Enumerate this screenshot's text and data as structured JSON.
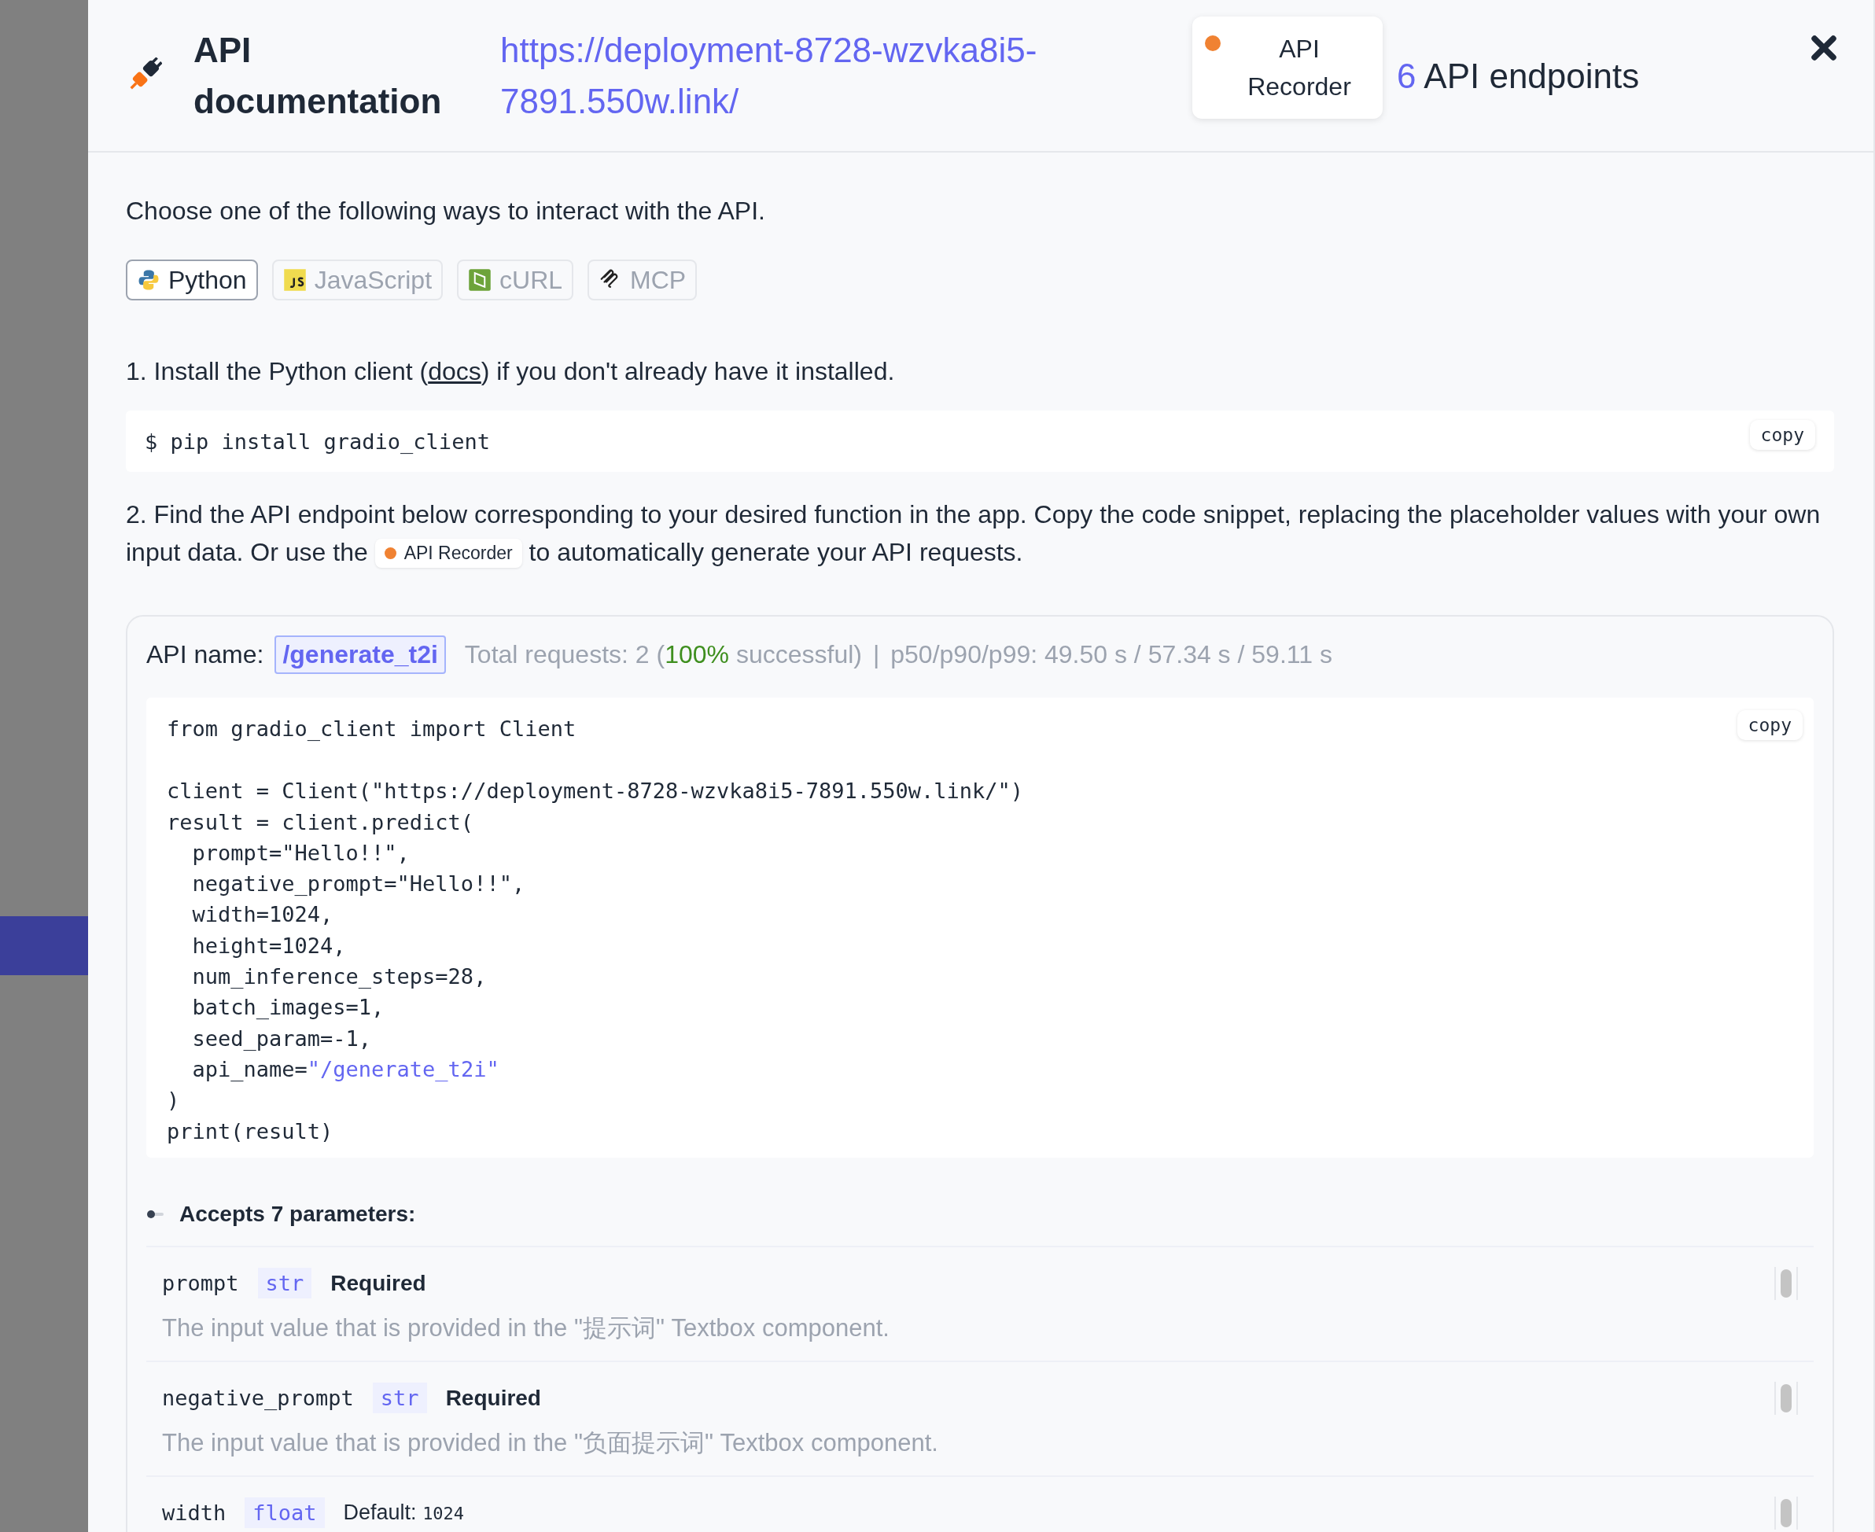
{
  "header": {
    "title": "API documentation",
    "url": "https://deployment-8728-wzvka8i5-7891.550w.link/",
    "recorder_button": "API Recorder",
    "endpoint_count": "6",
    "endpoint_label": "API endpoints"
  },
  "intro": "Choose one of the following ways to interact with the API.",
  "tabs": [
    {
      "label": "Python",
      "kind": "python",
      "selected": true
    },
    {
      "label": "JavaScript",
      "kind": "javascript",
      "selected": false
    },
    {
      "label": "cURL",
      "kind": "curl",
      "selected": false
    },
    {
      "label": "MCP",
      "kind": "mcp",
      "selected": false
    }
  ],
  "step1": {
    "before": "1. Install the Python client (",
    "link": "docs",
    "after": ") if you don't already have it installed."
  },
  "install": {
    "command": "$ pip install gradio_client",
    "copy": "copy"
  },
  "step2": {
    "before": "2. Find the API endpoint below corresponding to your desired function in the app. Copy the code snippet, replacing the placeholder values with your own input data. Or use the",
    "chip": "API Recorder",
    "after": "to automatically generate your API requests."
  },
  "endpoint": {
    "label": "API name:",
    "name": "/generate_t2i",
    "stats_before": "Total requests: 2 (",
    "success": "100%",
    "stats_after": " successful)",
    "separator": "|",
    "latency": "p50/p90/p99: 49.50 s / 57.34 s / 59.11 s",
    "copy": "copy",
    "code_groups": [
      [
        [
          {
            "text": "from gradio_client import Client",
            "kind": "plain"
          }
        ]
      ],
      [
        [
          {
            "text": "client = Client(\"https://deployment-8728-wzvka8i5-7891.550w.link/\")",
            "kind": "plain"
          }
        ],
        [
          {
            "text": "result = client.predict(",
            "kind": "plain"
          }
        ],
        [
          {
            "text": "  prompt=\"Hello!!\",",
            "kind": "plain"
          }
        ],
        [
          {
            "text": "  negative_prompt=\"Hello!!\",",
            "kind": "plain"
          }
        ],
        [
          {
            "text": "  width=1024,",
            "kind": "plain"
          }
        ],
        [
          {
            "text": "  height=1024,",
            "kind": "plain"
          }
        ],
        [
          {
            "text": "  num_inference_steps=28,",
            "kind": "plain"
          }
        ],
        [
          {
            "text": "  batch_images=1,",
            "kind": "plain"
          }
        ],
        [
          {
            "text": "  seed_param=-1,",
            "kind": "plain"
          }
        ],
        [
          {
            "text": "  api_name=",
            "kind": "plain"
          },
          {
            "text": "\"/generate_t2i\"",
            "kind": "string"
          }
        ],
        [
          {
            "text": ")",
            "kind": "plain"
          }
        ],
        [
          {
            "text": "print(result)",
            "kind": "plain"
          }
        ]
      ]
    ],
    "params_heading": "Accepts 7 parameters:",
    "params": [
      {
        "name": "prompt",
        "type": "str",
        "kind": "required",
        "requirement": "Required",
        "description": "The input value that is provided in the \"提示词\" Textbox component."
      },
      {
        "name": "negative_prompt",
        "type": "str",
        "kind": "required",
        "requirement": "Required",
        "description": "The input value that is provided in the \"负面提示词\" Textbox component."
      },
      {
        "name": "width",
        "type": "float",
        "kind": "default",
        "requirement": "Default:",
        "default": "1024"
      }
    ]
  }
}
